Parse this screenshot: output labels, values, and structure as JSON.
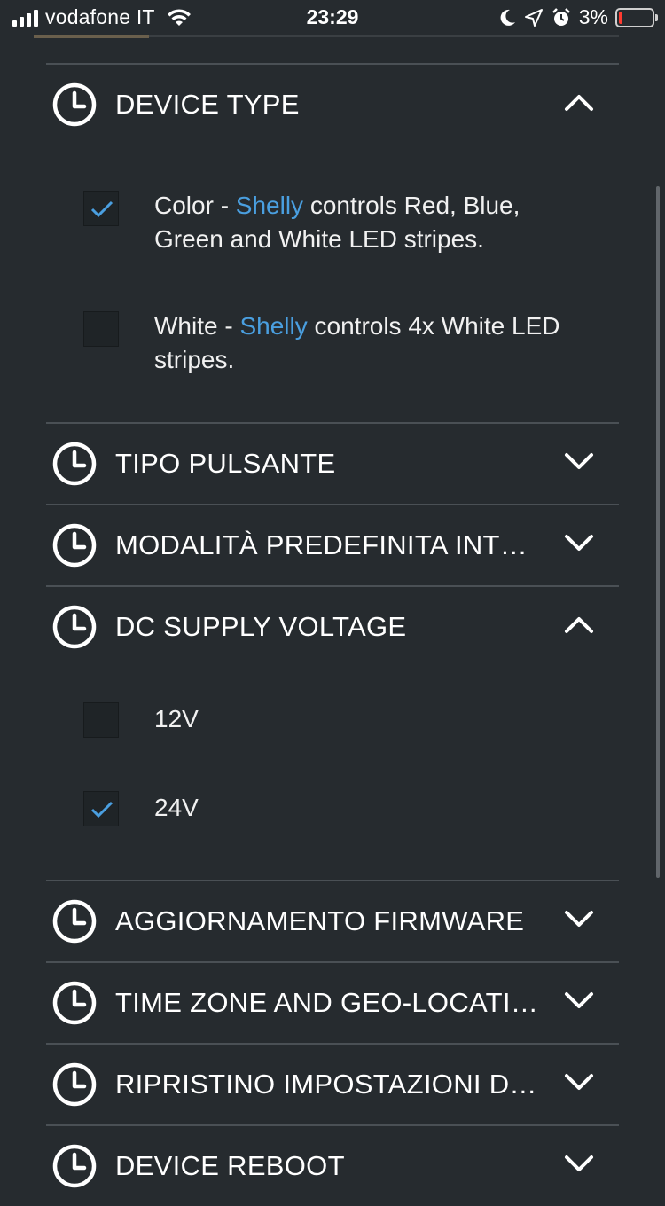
{
  "status_bar": {
    "carrier": "vodafone IT",
    "time": "23:29",
    "battery": "3%"
  },
  "sections": [
    {
      "title": "DEVICE TYPE",
      "expanded": true
    },
    {
      "title": "TIPO PULSANTE",
      "expanded": false
    },
    {
      "title": "MODALITÀ PREDEFINITA INTER…",
      "expanded": false
    },
    {
      "title": "DC SUPPLY VOLTAGE",
      "expanded": true
    },
    {
      "title": "AGGIORNAMENTO FIRMWARE",
      "expanded": false
    },
    {
      "title": "TIME ZONE AND GEO-LOCATION",
      "expanded": false
    },
    {
      "title": "RIPRISTINO IMPOSTAZIONI DI F…",
      "expanded": false
    },
    {
      "title": "DEVICE REBOOT",
      "expanded": false
    }
  ],
  "device_type": {
    "options": [
      {
        "prefix": "Color - ",
        "brand": "Shelly",
        "suffix": " controls Red, Blue, Green and White LED stripes.",
        "checked": true
      },
      {
        "prefix": "White - ",
        "brand": "Shelly",
        "suffix": " controls 4x White LED stripes.",
        "checked": false
      }
    ]
  },
  "voltage": {
    "options": [
      {
        "label": "12V",
        "checked": false
      },
      {
        "label": "24V",
        "checked": true
      }
    ]
  },
  "colors": {
    "accent": "#4a9fe0",
    "background": "#262b2f"
  }
}
